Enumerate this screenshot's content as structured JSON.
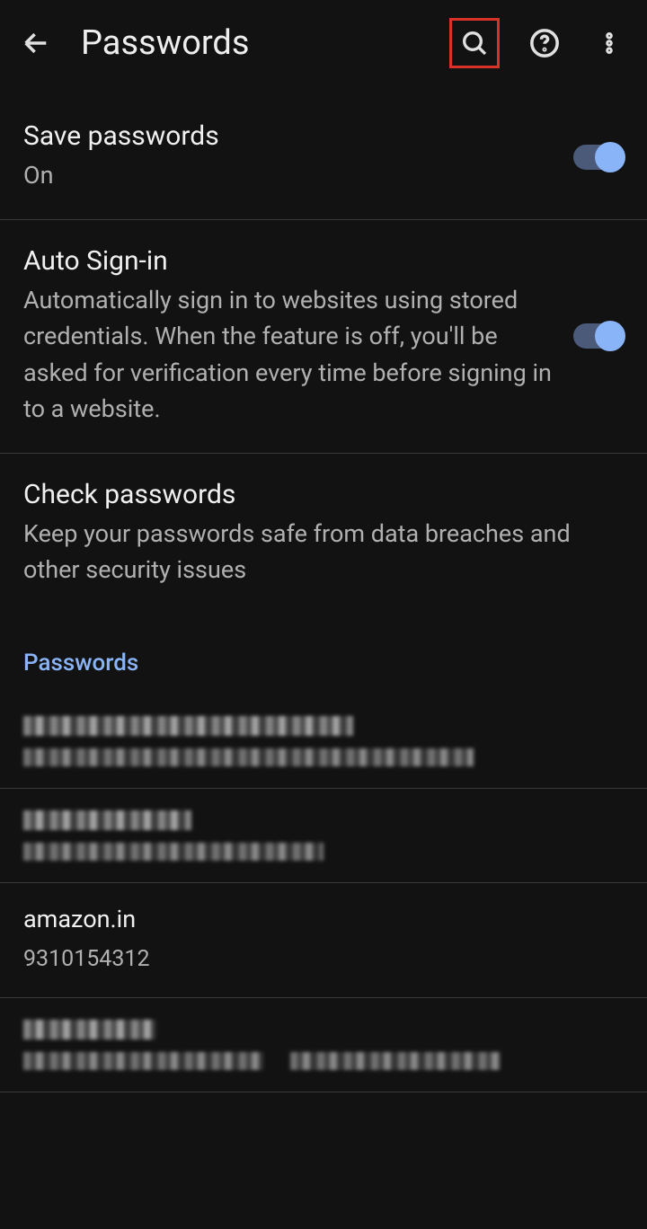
{
  "header": {
    "title": "Passwords"
  },
  "settings": {
    "savePasswords": {
      "title": "Save passwords",
      "status": "On"
    },
    "autoSignin": {
      "title": "Auto Sign-in",
      "description": "Automatically sign in to websites using stored credentials. When the feature is off, you'll be asked for verification every time before signing in to a website."
    },
    "checkPasswords": {
      "title": "Check passwords",
      "description": "Keep your passwords safe from data breaches and other security issues"
    }
  },
  "section": {
    "passwordsLabel": "Passwords"
  },
  "entries": [
    {
      "site": "amazon.in",
      "user": "9310154312"
    }
  ]
}
